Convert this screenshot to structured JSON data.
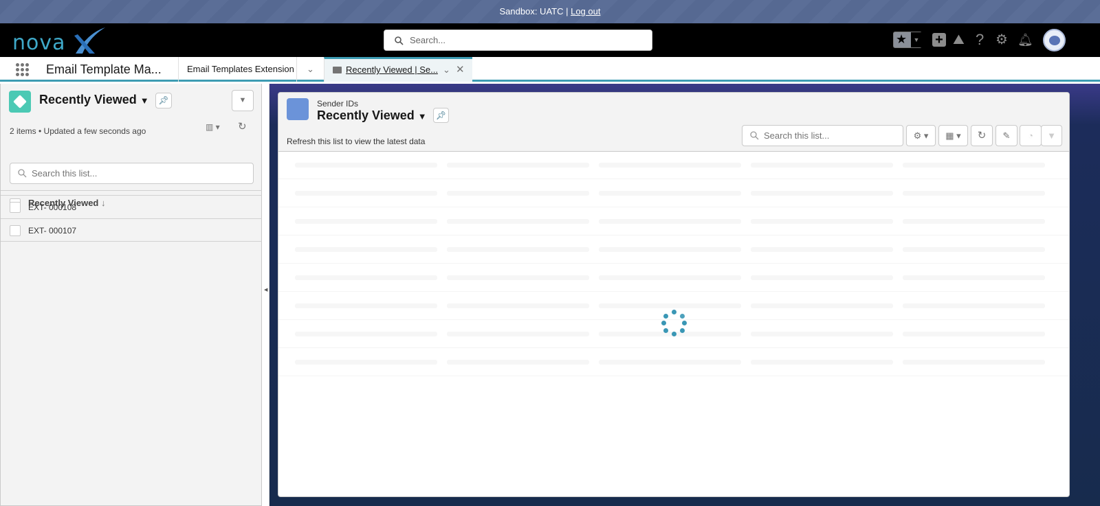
{
  "sandbox": {
    "text": "Sandbox: UATC | ",
    "logout": "Log out"
  },
  "header": {
    "logo_text": "novaX",
    "search_placeholder": "Search...",
    "icons": [
      "favorites-star-icon",
      "add-icon",
      "trailhead-icon",
      "help-icon",
      "setup-gear-icon",
      "notification-bell-icon",
      "avatar"
    ]
  },
  "tabbar": {
    "app_name": "Email Template Ma...",
    "tabs": [
      {
        "label": "Email Templates Extension"
      },
      {
        "label": "Recently Viewed | Se..."
      }
    ]
  },
  "left": {
    "title": "Recently Viewed",
    "status": "2 items • Updated a few seconds ago",
    "search_placeholder": "Search this list...",
    "column": "Recently Viewed",
    "rows": [
      "EXT- 000108",
      "EXT- 000107"
    ],
    "icon_color": "#4bc9b4"
  },
  "main": {
    "object": "Sender IDs",
    "title": "Recently Viewed",
    "hint": "Refresh this list to view the latest data",
    "search_placeholder": "Search this list...",
    "icon_color": "#6b93d9"
  }
}
